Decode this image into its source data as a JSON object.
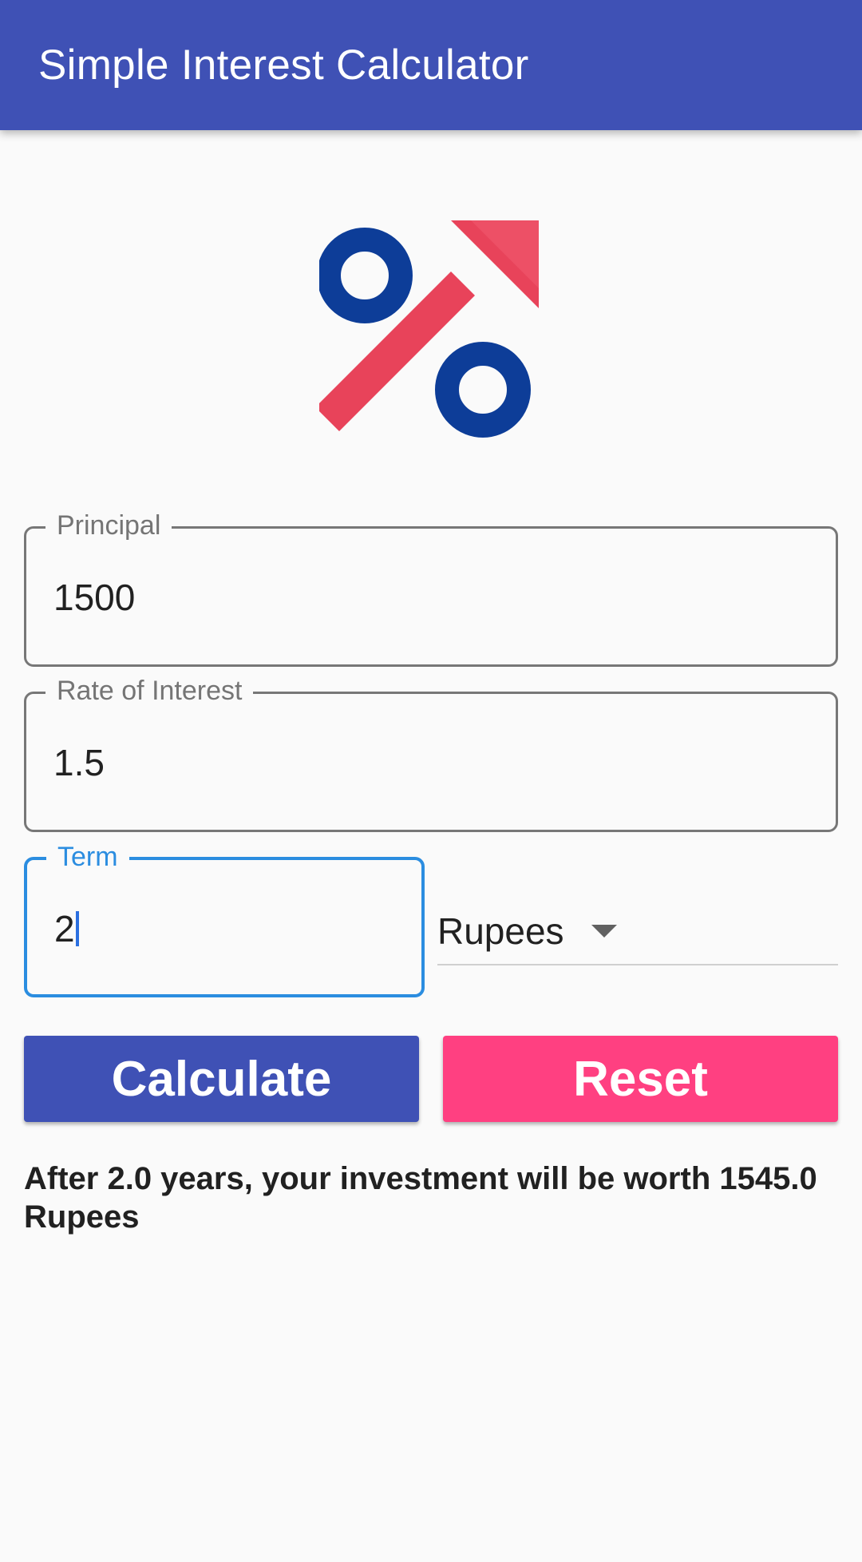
{
  "app_bar": {
    "title": "Simple Interest Calculator"
  },
  "logo": {
    "icon": "percent-up-arrow-icon",
    "colors": {
      "circles": "#0d3d98",
      "arrow": "#e8435a"
    }
  },
  "form": {
    "principal": {
      "label": "Principal",
      "value": "1500"
    },
    "rate": {
      "label": "Rate of Interest",
      "value": "1.5"
    },
    "term": {
      "label": "Term",
      "value": "2"
    },
    "currency": {
      "selected": "Rupees"
    }
  },
  "buttons": {
    "calculate": "Calculate",
    "reset": "Reset"
  },
  "result": {
    "text": "After 2.0 years, your investment will be worth 1545.0 Rupees"
  },
  "colors": {
    "primary": "#3f51b5",
    "accent": "#ff4081",
    "focus": "#2b8de0"
  }
}
